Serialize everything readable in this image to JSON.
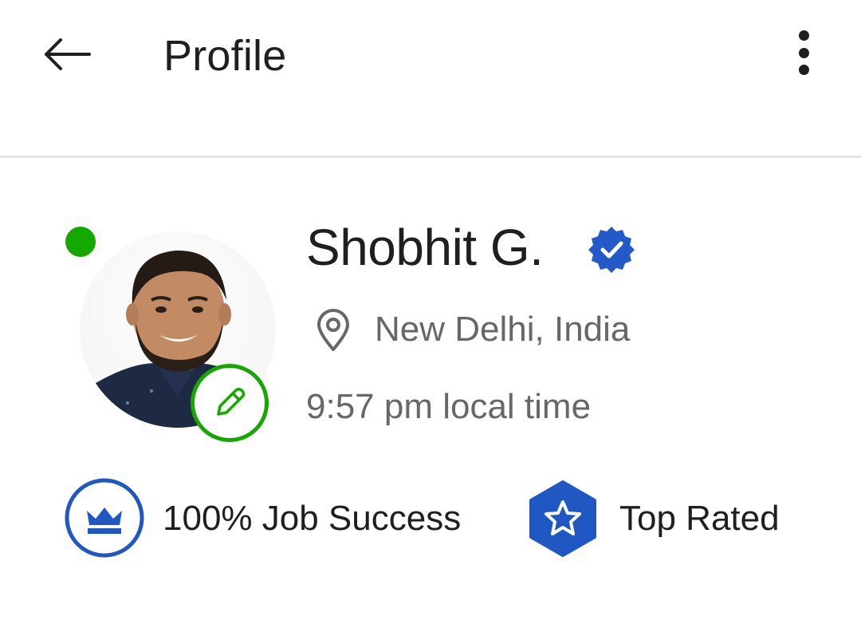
{
  "header": {
    "title": "Profile",
    "back_icon": "arrow-left-icon",
    "menu_icon": "more-vertical-icon"
  },
  "profile": {
    "name": "Shobhit G.",
    "verified_icon": "verified-badge-icon",
    "online": true,
    "location": "New Delhi, India",
    "location_icon": "map-pin-icon",
    "local_time": "9:57 pm local time",
    "edit_icon": "pencil-icon"
  },
  "badges": [
    {
      "label": "100% Job Success",
      "icon": "crown-icon"
    },
    {
      "label": "Top Rated",
      "icon": "star-hexagon-icon"
    }
  ],
  "colors": {
    "online_green": "#14a800",
    "edit_green": "#14a800",
    "badge_blue": "#1f57c3",
    "verified_blue": "#2459c9",
    "text_primary": "#1f1f1f",
    "text_secondary": "#676767",
    "divider": "#e2e2e2"
  }
}
